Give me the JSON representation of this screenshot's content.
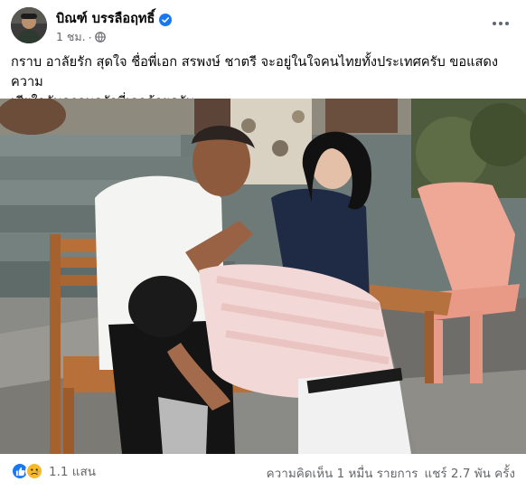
{
  "post": {
    "author": "บิณฑ์ บรรลือฤทธิ์",
    "time": "1 ชม.",
    "dot": "·",
    "caption_line1": "กราบ อาลัยรัก สุดใจ ชื่อพี่เอก สรพงษ์ ชาตรี จะอยู่ในใจคนไทยทั้งประเทศครับ ขอแสดงความ",
    "caption_line2": "เสียใจกับครอบครัวพี่เอกด้วยครับ..",
    "photo_description_icon": "photo",
    "reaction_count": "1.1 แสน",
    "comments": "ความคิดเห็น 1 หมื่น รายการ",
    "shares": "แชร์ 2.7 พัน ครั้ง"
  },
  "colors": {
    "accent": "#1877f2",
    "secondary_text": "#65676b",
    "sad_reaction": "#f7b928"
  },
  "icons": [
    "verified-badge-icon",
    "globe-icon",
    "more-options-icon",
    "like-reaction-icon",
    "sad-reaction-icon"
  ]
}
